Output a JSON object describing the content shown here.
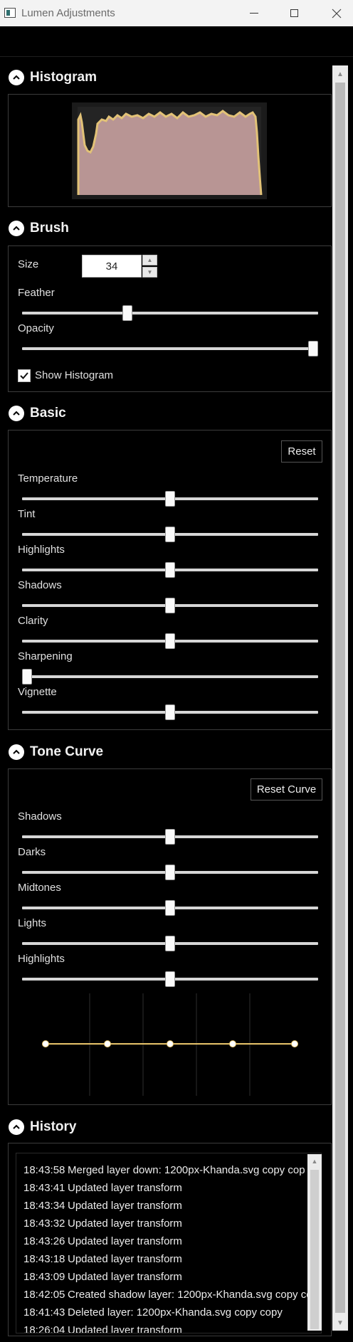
{
  "window": {
    "title": "Lumen Adjustments"
  },
  "histogram": {
    "title": "Histogram",
    "fill_color": "#b89594",
    "line_color": "#e2c277"
  },
  "brush": {
    "title": "Brush",
    "size_label": "Size",
    "size_value": "34",
    "feather_label": "Feather",
    "feather_value": 0.35,
    "opacity_label": "Opacity",
    "opacity_value": 1.0,
    "show_histogram_label": "Show Histogram",
    "show_histogram_checked": true
  },
  "basic": {
    "title": "Basic",
    "reset_label": "Reset",
    "sliders": [
      {
        "label": "Temperature",
        "value": 0.5
      },
      {
        "label": "Tint",
        "value": 0.5
      },
      {
        "label": "Highlights",
        "value": 0.5
      },
      {
        "label": "Shadows",
        "value": 0.5
      },
      {
        "label": "Clarity",
        "value": 0.5
      },
      {
        "label": "Sharpening",
        "value": 0.0
      },
      {
        "label": "Vignette",
        "value": 0.5
      }
    ]
  },
  "tone_curve": {
    "title": "Tone Curve",
    "reset_label": "Reset Curve",
    "sliders": [
      {
        "label": "Shadows",
        "value": 0.5
      },
      {
        "label": "Darks",
        "value": 0.5
      },
      {
        "label": "Midtones",
        "value": 0.5
      },
      {
        "label": "Lights",
        "value": 0.5
      },
      {
        "label": "Highlights",
        "value": 0.5
      }
    ],
    "curve_color": "#e8c46a"
  },
  "history": {
    "title": "History",
    "entries": [
      {
        "time": "18:43:58",
        "text": "Merged layer down: 1200px-Khanda.svg copy cop"
      },
      {
        "time": "18:43:41",
        "text": "Updated layer transform"
      },
      {
        "time": "18:43:34",
        "text": "Updated layer transform"
      },
      {
        "time": "18:43:32",
        "text": "Updated layer transform"
      },
      {
        "time": "18:43:26",
        "text": "Updated layer transform"
      },
      {
        "time": "18:43:18",
        "text": "Updated layer transform"
      },
      {
        "time": "18:43:09",
        "text": "Updated layer transform"
      },
      {
        "time": "18:42:05",
        "text": "Created shadow layer: 1200px-Khanda.svg copy co"
      },
      {
        "time": "18:41:43",
        "text": "Deleted layer: 1200px-Khanda.svg copy copy"
      },
      {
        "time": "18:26:04",
        "text": "Updated layer transform"
      }
    ]
  },
  "icons": {
    "app": "app-icon",
    "collapse": "chevron-up-icon",
    "check": "checkmark-icon",
    "spin_up": "caret-up-icon",
    "spin_down": "caret-down-icon"
  }
}
